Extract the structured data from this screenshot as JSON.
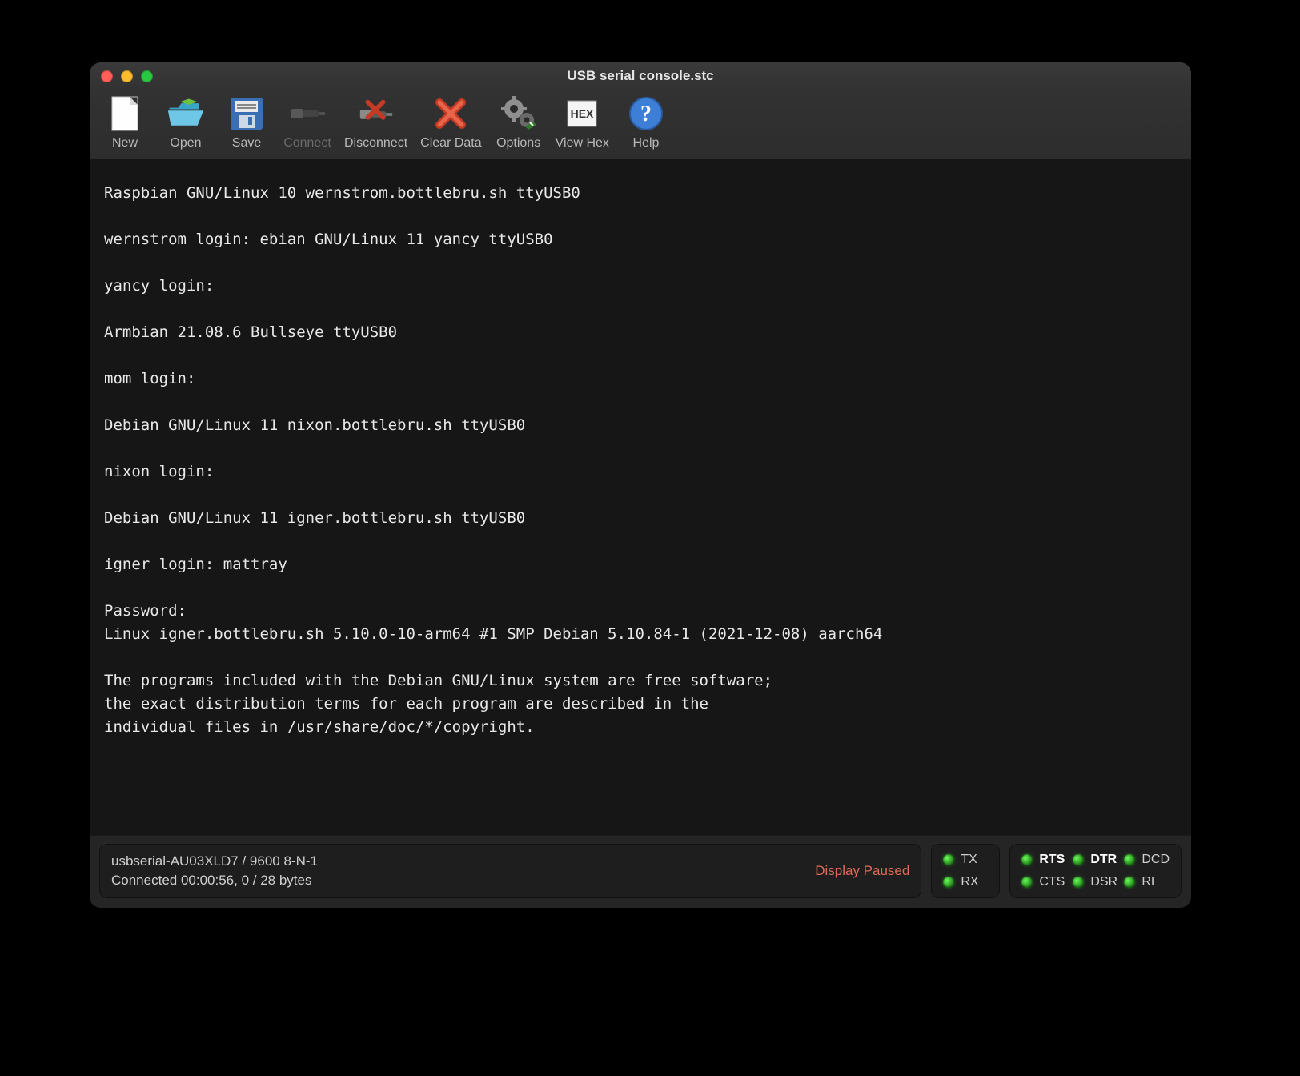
{
  "window": {
    "title": "USB serial console.stc"
  },
  "toolbar": {
    "new": {
      "label": "New"
    },
    "open": {
      "label": "Open"
    },
    "save": {
      "label": "Save"
    },
    "connect": {
      "label": "Connect"
    },
    "disconnect": {
      "label": "Disconnect"
    },
    "cleardata": {
      "label": "Clear Data"
    },
    "options": {
      "label": "Options"
    },
    "viewhex": {
      "label": "View Hex"
    },
    "help": {
      "label": "Help"
    }
  },
  "console_text": "Raspbian GNU/Linux 10 wernstrom.bottlebru.sh ttyUSB0\n\nwernstrom login: ebian GNU/Linux 11 yancy ttyUSB0\n\nyancy login:\n\nArmbian 21.08.6 Bullseye ttyUSB0\n\nmom login:\n\nDebian GNU/Linux 11 nixon.bottlebru.sh ttyUSB0\n\nnixon login:\n\nDebian GNU/Linux 11 igner.bottlebru.sh ttyUSB0\n\nigner login: mattray\n\nPassword:\nLinux igner.bottlebru.sh 5.10.0-10-arm64 #1 SMP Debian 5.10.84-1 (2021-12-08) aarch64\n\nThe programs included with the Debian GNU/Linux system are free software;\nthe exact distribution terms for each program are described in the\nindividual files in /usr/share/doc/*/copyright.",
  "status": {
    "line1": "usbserial-AU03XLD7 / 9600 8-N-1",
    "line2": "Connected 00:00:56, 0 / 28 bytes",
    "display_state": "Display Paused",
    "leds_txrx": {
      "tx": "TX",
      "rx": "RX"
    },
    "leds_ctrl": {
      "rts": "RTS",
      "dtr": "DTR",
      "dcd": "DCD",
      "cts": "CTS",
      "dsr": "DSR",
      "ri": "RI"
    }
  }
}
